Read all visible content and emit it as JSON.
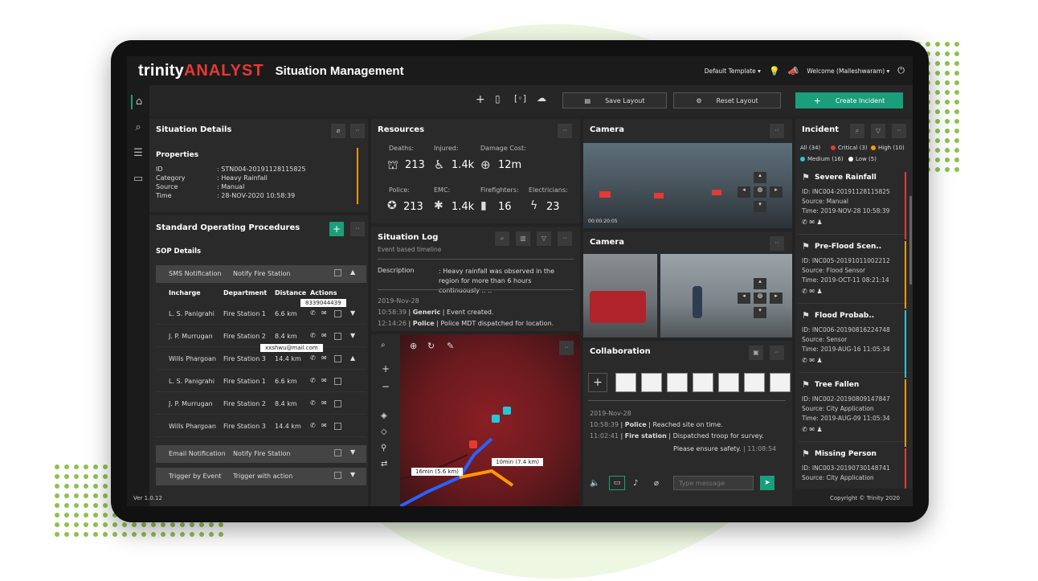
{
  "header": {
    "brand_a": "trinity",
    "brand_b": "ANALYST",
    "title": "Situation Management",
    "template": "Default Template",
    "welcome": "Welcome (Malleshwaram)"
  },
  "toolbar": {
    "save_layout": "Save Layout",
    "reset_layout": "Reset Layout",
    "create_incident": "Create Incident"
  },
  "situation": {
    "title": "Situation Details",
    "props_title": "Properties",
    "rows": [
      {
        "k": "ID",
        "v": ": STN004-20191128115825"
      },
      {
        "k": "Category",
        "v": ": Heavy Rainfall"
      },
      {
        "k": "Source",
        "v": ": Manual"
      },
      {
        "k": "Time",
        "v": ": 28-NOV-2020 10:58:39"
      }
    ]
  },
  "sop": {
    "title": "Standard Operating Procedures",
    "details": "SOP Details",
    "group1": {
      "a": "SMS Notification",
      "b": "Notify Fire Station"
    },
    "headers": [
      "Incharge",
      "Department",
      "Distance",
      "Actions"
    ],
    "tooltip_phone": "8339044439",
    "tooltip_email": "xxshwu@mail.com",
    "rows1": [
      [
        "L. S. Panigrahi",
        "Fire Station 1",
        "6.6 km"
      ],
      [
        "J. P. Murrugan",
        "Fire Station 2",
        "8.4 km"
      ],
      [
        "Wills Phargoan",
        "Fire Station 3",
        "14.4 km"
      ]
    ],
    "rows2": [
      [
        "L. S. Panigrahi",
        "Fire Station 1",
        "6.6 km"
      ],
      [
        "J. P. Murrugan",
        "Fire Station 2",
        "8.4 km"
      ],
      [
        "Wills Phargoan",
        "Fire Station 3",
        "14.4 km"
      ]
    ],
    "group2": {
      "a": "Email Notification",
      "b": "Notify Fire Station"
    },
    "group3": {
      "a": "Trigger by Event",
      "b": "Trigger with action"
    }
  },
  "resources": {
    "title": "Resources",
    "top": [
      {
        "label": "Deaths:",
        "value": "213"
      },
      {
        "label": "Injured:",
        "value": "1.4k"
      },
      {
        "label": "Damage Cost:",
        "value": "12m"
      }
    ],
    "bottom": [
      {
        "label": "Police:",
        "value": "213"
      },
      {
        "label": "EMC:",
        "value": "1.4k"
      },
      {
        "label": "Firefighters:",
        "value": "16"
      },
      {
        "label": "Electricians:",
        "value": "23"
      }
    ]
  },
  "log": {
    "title": "Situation Log",
    "subtitle": "Event based timeline",
    "desc_label": "Description",
    "desc": ": Heavy rainfall was observed in the region for more than 6 hours continuously .. ..",
    "date": "2019-Nov-28",
    "entries": [
      {
        "time": "10:58:39",
        "type": "Generic",
        "text": "Event created."
      },
      {
        "time": "12:14:26",
        "type": "Police",
        "text": "Police MDT dispatched for location."
      }
    ]
  },
  "map": {
    "route1": "16min (5.6 km)",
    "route2": "10min (7.4 km)"
  },
  "camera": {
    "title1": "Camera",
    "title2": "Camera",
    "ts": "00:00:20:05"
  },
  "collab": {
    "title": "Collaboration",
    "date": "2019-Nov-28",
    "entries": [
      {
        "time": "10:58:39",
        "who": "Police",
        "text": "Reached site on time."
      },
      {
        "time": "11:02:41",
        "who": "Fire station",
        "text": "Dispatched troop for survey."
      }
    ],
    "last": "Please ensure safety.",
    "last_time": "11:08:54",
    "placeholder": "Type message"
  },
  "incident": {
    "title": "Incident",
    "filters": [
      {
        "label": "All (34)",
        "color": ""
      },
      {
        "label": "Critical (3)",
        "color": "#e53935"
      },
      {
        "label": "High (10)",
        "color": "#ff9800"
      },
      {
        "label": "Medium (16)",
        "color": "#26c6da"
      },
      {
        "label": "Low (5)",
        "color": "#ffffff"
      }
    ],
    "items": [
      {
        "name": "Severe Rainfall",
        "id": "ID: INC004-20191128115825",
        "source": "Source: Manual",
        "time": "Time: 2019-NOV-28 10:58:39",
        "color": "#e53935"
      },
      {
        "name": "Pre-Flood Scen..",
        "id": "ID: INC005-20191011002212",
        "source": "Source: Flood Sensor",
        "time": "Time: 2019-OCT-11 08:21:14",
        "color": "#ff9800"
      },
      {
        "name": "Flood Probab..",
        "id": "ID: INC006-20190816224748",
        "source": "Source: Sensor",
        "time": "Time: 2019-AUG-16 11:05:34",
        "color": "#26c6da"
      },
      {
        "name": "Tree Fallen",
        "id": "ID: INC002-20190809147847",
        "source": "Source: City Application",
        "time": "Time: 2019-AUG-09 11:05:34",
        "color": "#ff9800"
      },
      {
        "name": "Missing Person",
        "id": "ID: INC003-20190730148741",
        "source": "Source: City Application",
        "time": "",
        "color": "#e53935"
      }
    ]
  },
  "footer": {
    "version": "Ver 1.0.12",
    "copyright": "Copyright © Trinity 2020"
  }
}
